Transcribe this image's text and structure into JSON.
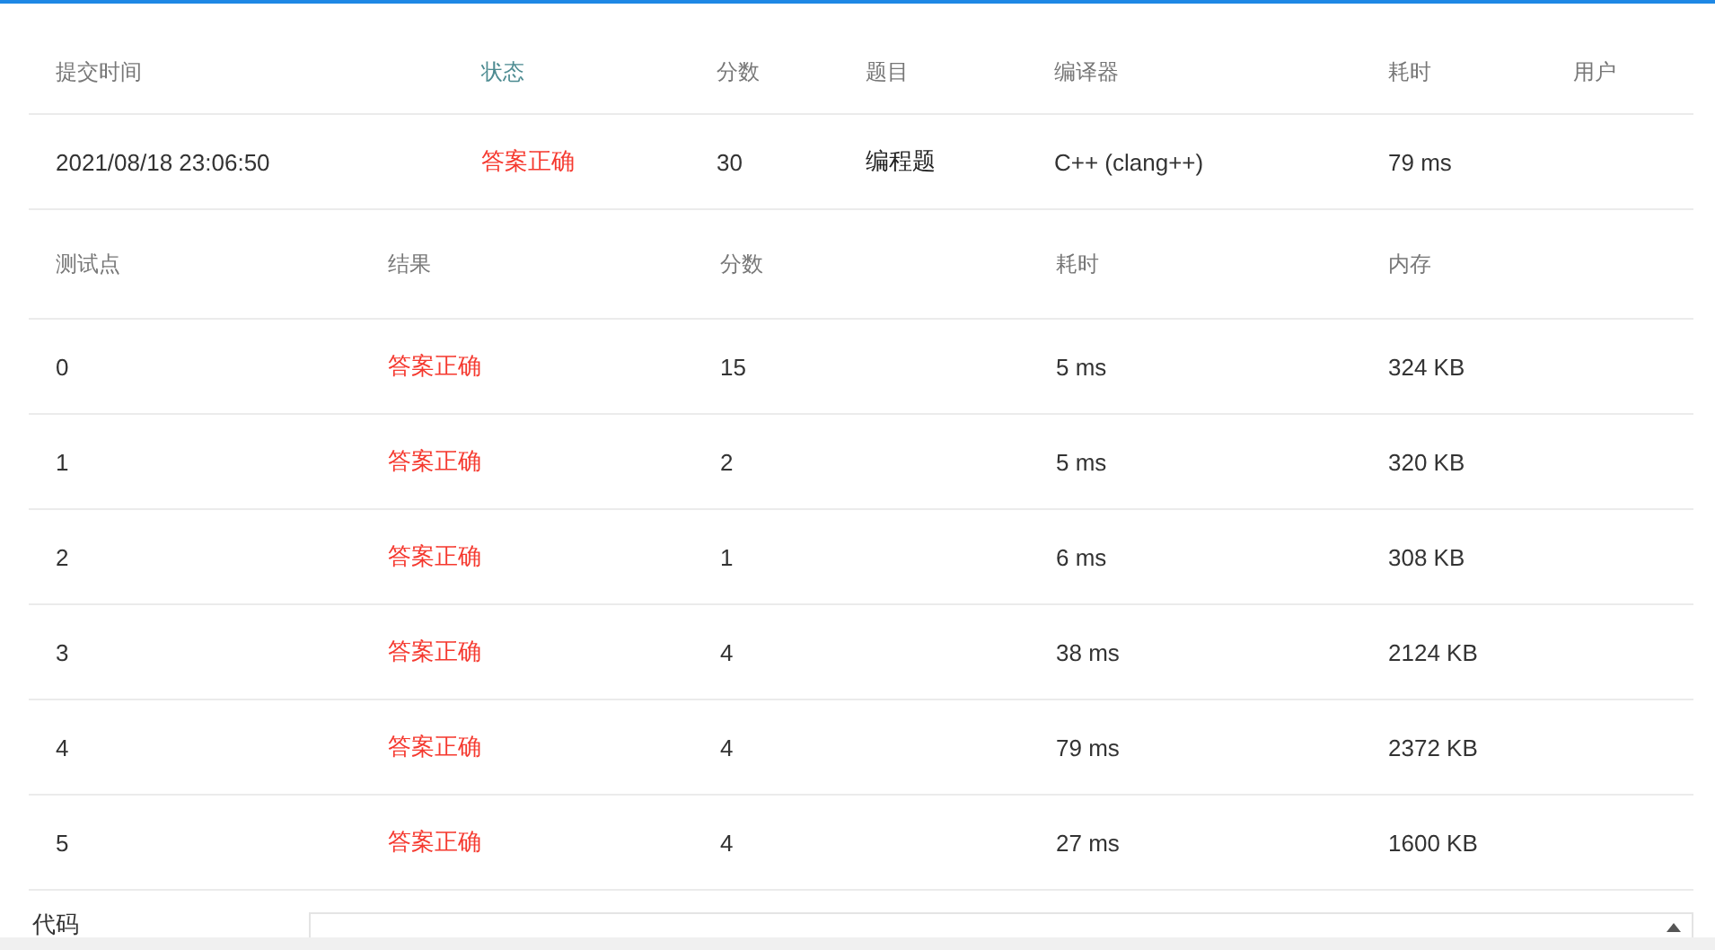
{
  "submission": {
    "columns": [
      {
        "label": "提交时间",
        "kind": "plain"
      },
      {
        "label": "状态",
        "kind": "status"
      },
      {
        "label": "分数",
        "kind": "plain"
      },
      {
        "label": "题目",
        "kind": "plain"
      },
      {
        "label": "编译器",
        "kind": "plain"
      },
      {
        "label": "耗时",
        "kind": "plain"
      },
      {
        "label": "用户",
        "kind": "plain"
      }
    ],
    "row": [
      {
        "text": "2021/08/18 23:06:50",
        "kind": "plain"
      },
      {
        "text": "答案正确",
        "kind": "accepted"
      },
      {
        "text": "30",
        "kind": "plain"
      },
      {
        "text": "编程题",
        "kind": "dark"
      },
      {
        "text": "C++ (clang++)",
        "kind": "plain"
      },
      {
        "text": "79 ms",
        "kind": "plain"
      }
    ]
  },
  "tests": {
    "columns": [
      "测试点",
      "结果",
      "分数",
      "耗时",
      "内存"
    ],
    "rows": [
      {
        "case": "0",
        "result": {
          "text": "答案正确",
          "kind": "accepted"
        },
        "score": "15",
        "time": "5 ms",
        "memory": "324 KB"
      },
      {
        "case": "1",
        "result": {
          "text": "答案正确",
          "kind": "accepted"
        },
        "score": "2",
        "time": "5 ms",
        "memory": "320 KB"
      },
      {
        "case": "2",
        "result": {
          "text": "答案正确",
          "kind": "accepted"
        },
        "score": "1",
        "time": "6 ms",
        "memory": "308 KB"
      },
      {
        "case": "3",
        "result": {
          "text": "答案正确",
          "kind": "accepted"
        },
        "score": "4",
        "time": "38 ms",
        "memory": "2124 KB"
      },
      {
        "case": "4",
        "result": {
          "text": "答案正确",
          "kind": "accepted"
        },
        "score": "4",
        "time": "79 ms",
        "memory": "2372 KB"
      },
      {
        "case": "5",
        "result": {
          "text": "答案正确",
          "kind": "accepted"
        },
        "score": "4",
        "time": "27 ms",
        "memory": "1600 KB"
      }
    ]
  },
  "code": {
    "label": "代码"
  }
}
